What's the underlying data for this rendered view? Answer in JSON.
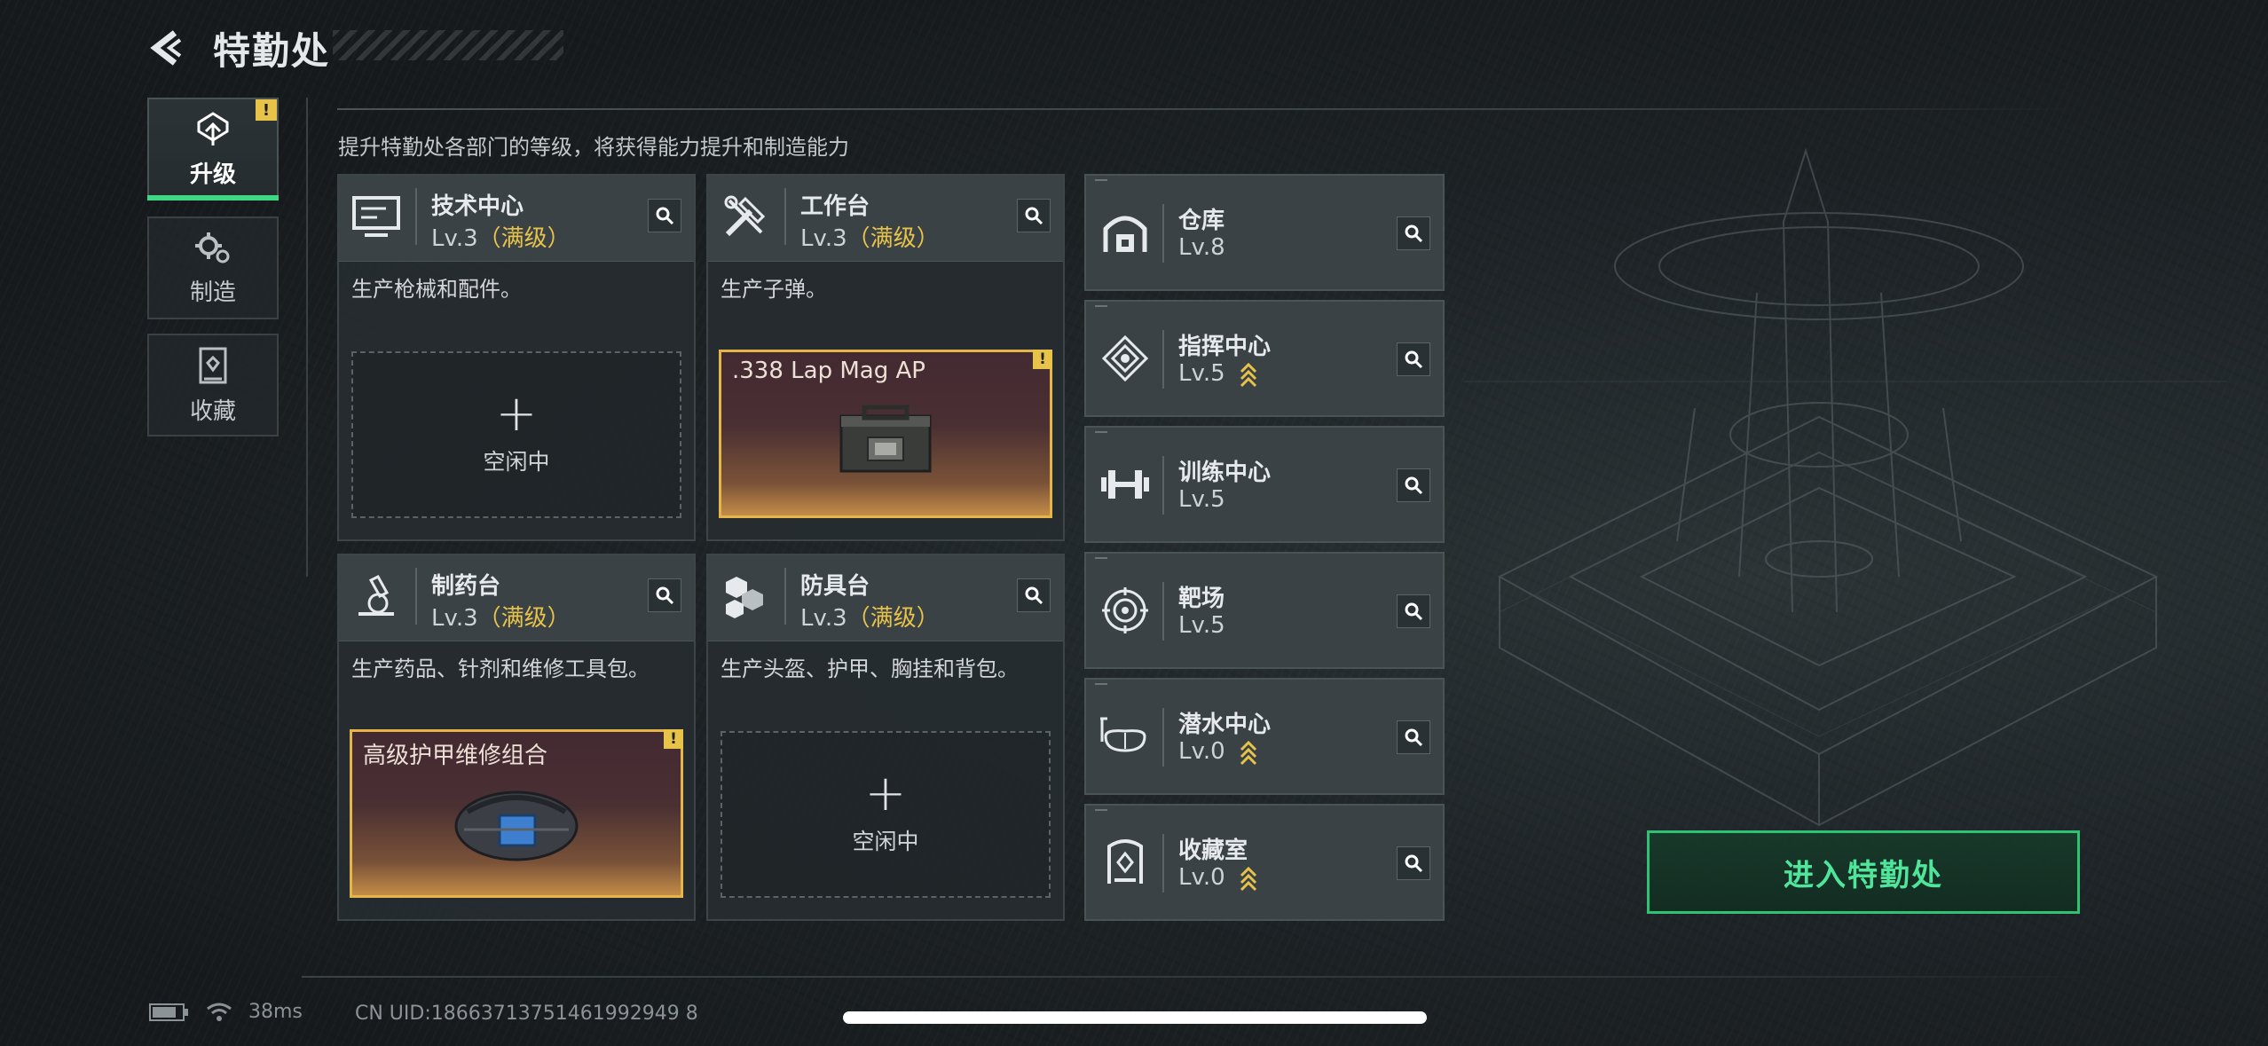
{
  "header": {
    "title": "特勤处"
  },
  "tabs": [
    {
      "label": "升级",
      "active": true,
      "alert": "!"
    },
    {
      "label": "制造",
      "active": false
    },
    {
      "label": "收藏",
      "active": false
    }
  ],
  "subtitle": "提升特勤处各部门的等级，将获得能力提升和制造能力",
  "stations": [
    {
      "name": "技术中心",
      "level": "Lv.3",
      "max_tag": "（满级）",
      "icon": "monitor-icon",
      "desc": "生产枪械和配件。",
      "slot": {
        "type": "idle",
        "plus": "+",
        "text": "空闲中"
      }
    },
    {
      "name": "工作台",
      "level": "Lv.3",
      "max_tag": "（满级）",
      "icon": "tools-icon",
      "desc": "生产子弹。",
      "slot": {
        "type": "product",
        "name": ".338 Lap Mag AP",
        "alert": "!",
        "image": "ammo-box-icon"
      }
    },
    {
      "name": "制药台",
      "level": "Lv.3",
      "max_tag": "（满级）",
      "icon": "microscope-icon",
      "desc": "生产药品、针剂和维修工具包。",
      "slot": {
        "type": "product",
        "name": "高级护甲维修组合",
        "alert": "!",
        "image": "repair-bag-icon"
      }
    },
    {
      "name": "防具台",
      "level": "Lv.3",
      "max_tag": "（满级）",
      "icon": "armor-cubes-icon",
      "desc": "生产头盔、护甲、胸挂和背包。",
      "slot": {
        "type": "idle",
        "plus": "+",
        "text": "空闲中"
      }
    }
  ],
  "facilities": [
    {
      "name": "仓库",
      "level": "Lv.8",
      "upgradable": false,
      "icon": "warehouse-icon"
    },
    {
      "name": "指挥中心",
      "level": "Lv.5",
      "upgradable": true,
      "icon": "command-icon"
    },
    {
      "name": "训练中心",
      "level": "Lv.5",
      "upgradable": false,
      "icon": "dumbbell-icon"
    },
    {
      "name": "靶场",
      "level": "Lv.5",
      "upgradable": false,
      "icon": "target-icon"
    },
    {
      "name": "潜水中心",
      "level": "Lv.0",
      "upgradable": true,
      "icon": "dive-mask-icon"
    },
    {
      "name": "收藏室",
      "level": "Lv.0",
      "upgradable": true,
      "icon": "collection-icon"
    }
  ],
  "enter_button": "进入特勤处",
  "status": {
    "ping": "38ms",
    "uid": "CN UID:18663713751461992949 8"
  },
  "colors": {
    "accent_green": "#3fd684",
    "max_gold": "#e8c34a",
    "alert_yellow": "#e8c34a"
  }
}
